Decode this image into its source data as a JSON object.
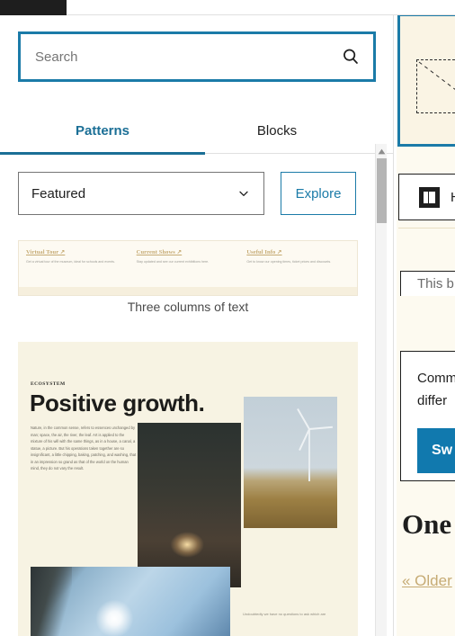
{
  "window": {
    "admin_bar_color": "#1e1e1e",
    "accent_color": "#1b7ba8",
    "canvas_bg": "#fdfaf0"
  },
  "inserter": {
    "search": {
      "placeholder": "Search",
      "value": "",
      "icon": "search-icon"
    },
    "tabs": [
      {
        "label": "Patterns",
        "active": true
      },
      {
        "label": "Blocks",
        "active": false
      }
    ],
    "filter": {
      "selected": "Featured",
      "chevron_icon": "chevron-down-icon",
      "explore_label": "Explore"
    },
    "patterns": [
      {
        "caption": "Three columns of text",
        "preview": {
          "columns": [
            {
              "title": "Virtual Tour ↗",
              "body": "Get a virtual tour of the museum, ideal for schools and events."
            },
            {
              "title": "Current Shows ↗",
              "body": "Stay updated and see our current exhibitions here."
            },
            {
              "title": "Useful Info ↗",
              "body": "Get to know our opening times, ticket prices and discounts."
            }
          ]
        }
      },
      {
        "caption": "",
        "preview": {
          "eyebrow": "ECOSYSTEM",
          "headline": "Positive growth.",
          "body": "Nature, in the common sense, refers to essences unchanged by man; space, the air, the river, the leaf. Art is applied to the mixture of his will with the same things, as in a house, a canal, a statue, a picture. But his operations taken together are so insignificant, a little chipping, baking, patching, and washing, that in an impression so grand as that of the world on the human mind, they do not vary the result.",
          "caption": "Undoubtedly we have no questions to ask which are",
          "images": [
            "forest-image",
            "wind-turbine-image",
            "sunny-sky-image"
          ]
        }
      }
    ],
    "scrollbar": {
      "up_arrow_icon": "scroll-up-arrow-icon",
      "thumb_label": "vertical-scroll-thumb"
    }
  },
  "canvas": {
    "image_placeholder": {
      "label": "image-placeholder-block",
      "selected": true
    },
    "media_text_block": {
      "icon": "media-and-text-icon",
      "text": "H"
    },
    "comment_block": {
      "text": "This b"
    },
    "switch_card": {
      "lines": [
        "Comm",
        "differ"
      ],
      "button_label": "Sw",
      "button_color": "#1179ae"
    },
    "post_heading": "One",
    "pagination_link": "« Older"
  }
}
